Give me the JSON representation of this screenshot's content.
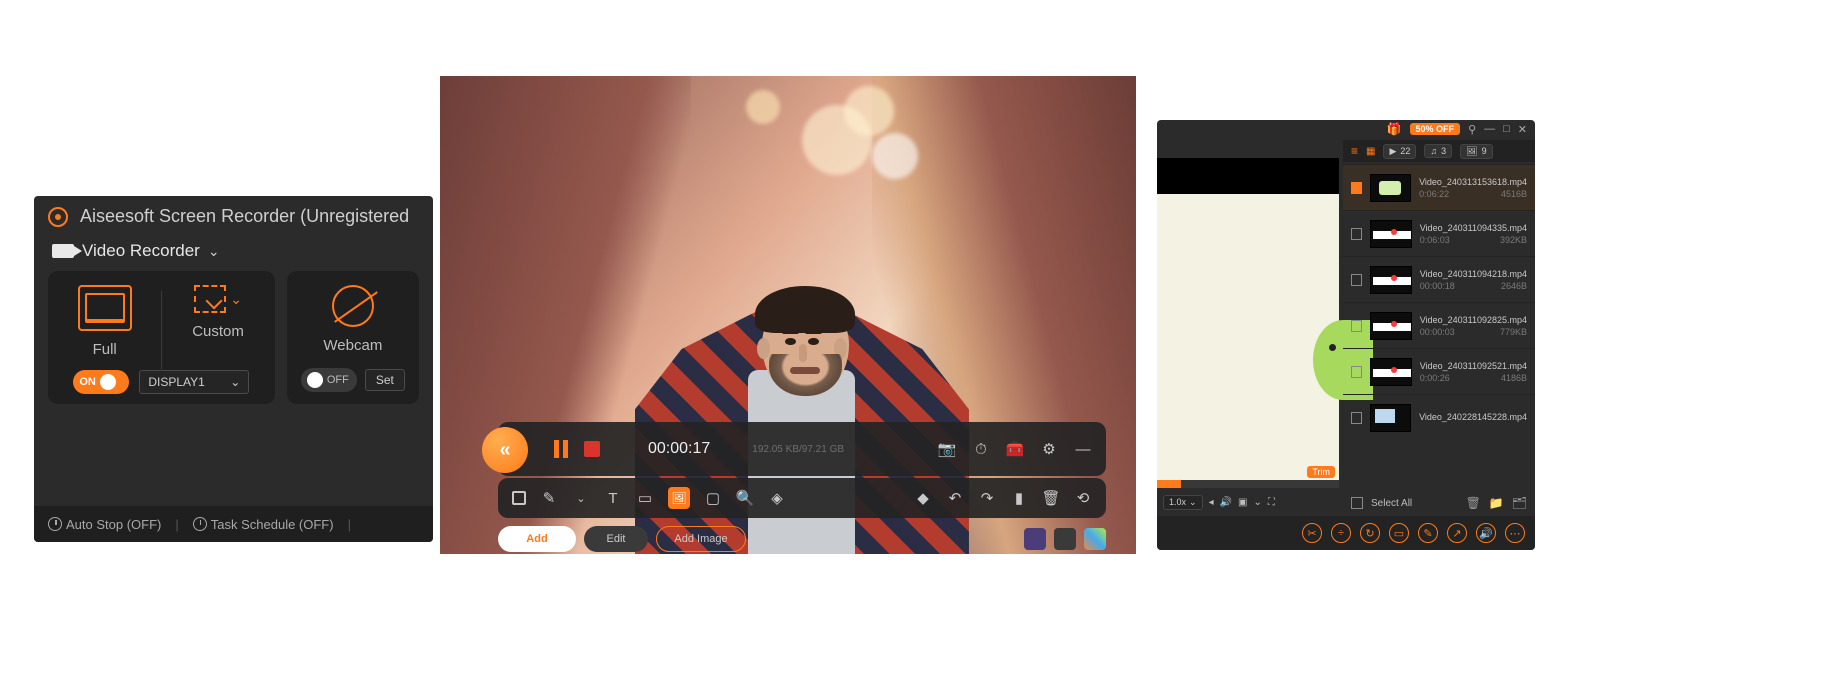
{
  "left": {
    "title": "Aiseesoft Screen Recorder (Unregistered",
    "mode": "Video Recorder",
    "full_label": "Full",
    "custom_label": "Custom",
    "webcam_label": "Webcam",
    "display_toggle_label": "ON",
    "display_dropdown": "DISPLAY1",
    "webcam_toggle_label": "OFF",
    "settings_btn": "Set",
    "auto_stop": "Auto Stop (OFF)",
    "task_schedule": "Task Schedule (OFF)"
  },
  "center": {
    "orb_glyph": "«",
    "timer": "00:00:17",
    "disk_info": "192.05 KB/97.21 GB",
    "btn_add": "Add",
    "btn_edit": "Edit",
    "btn_add_image": "Add Image"
  },
  "right": {
    "promo": "50% OFF",
    "tab_video_count": "22",
    "tab_audio_count": "3",
    "tab_image_count": "9",
    "speed": "1.0x",
    "trim_label": "Trim",
    "select_all": "Select All",
    "items": [
      {
        "name": "Video_240313153618.mp4",
        "dur": "0:06:22",
        "size": "4516B"
      },
      {
        "name": "Video_240311094335.mp4",
        "dur": "0:06:03",
        "size": "392KB"
      },
      {
        "name": "Video_240311094218.mp4",
        "dur": "00:00:18",
        "size": "2646B"
      },
      {
        "name": "Video_240311092825.mp4",
        "dur": "00:00:03",
        "size": "779KB"
      },
      {
        "name": "Video_240311092521.mp4",
        "dur": "0:00:26",
        "size": "4186B"
      },
      {
        "name": "Video_240228145228.mp4",
        "dur": "",
        "size": ""
      }
    ]
  }
}
